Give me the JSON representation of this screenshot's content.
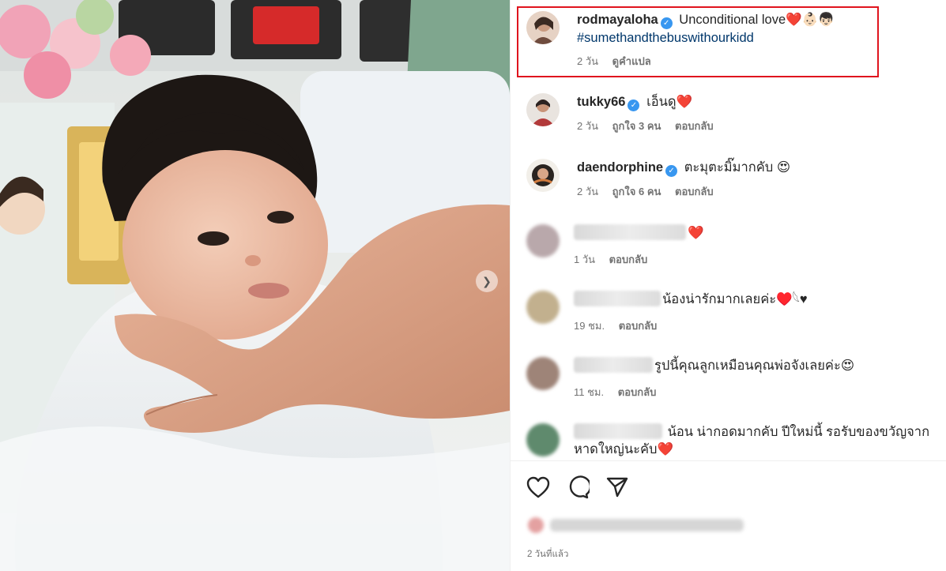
{
  "post": {
    "author": "rodmayaloha",
    "caption": "Unconditional love❤️👶🏻👦🏻",
    "hashtag": "#sumethandthebuswithourkidd",
    "time": "2 วัน",
    "translate_label": "ดูคำแปล",
    "posted_ago": "2 วันที่แล้ว"
  },
  "comments": [
    {
      "username": "tukky66",
      "verified": true,
      "text": "เอ็นดู❤️",
      "time": "2 วัน",
      "likes": "ถูกใจ 3 คน",
      "reply": "ตอบกลับ"
    },
    {
      "username": "daendorphine",
      "verified": true,
      "text": "ตะมุตะมิ๊มากคับ 😍",
      "time": "2 วัน",
      "likes": "ถูกใจ 6 คน",
      "reply": "ตอบกลับ"
    },
    {
      "username": "",
      "verified": false,
      "text": "❤️",
      "time": "1 วัน",
      "likes": "",
      "reply": "ตอบกลับ"
    },
    {
      "username": "",
      "verified": false,
      "text": "น้องน่ารักมากเลยค่ะ♥️𓆩♥",
      "time": "19 ชม.",
      "likes": "",
      "reply": "ตอบกลับ"
    },
    {
      "username": "",
      "verified": false,
      "text": "รูปนี้คุณลูกเหมือนคุณพ่อจังเลยค่ะ😍",
      "time": "11 ชม.",
      "likes": "",
      "reply": "ตอบกลับ"
    },
    {
      "username": "",
      "verified": false,
      "text": "น้อน น่ากอดมากคับ ปีใหม่นี้ รอรับของขวัญจาก",
      "text2": "หาดใหญ่นะคับ❤️",
      "time": "",
      "likes": "",
      "reply": ""
    }
  ],
  "icons": {
    "like": "heart-outline-icon",
    "comment": "comment-bubble-icon",
    "share": "paper-plane-icon",
    "next": "chevron-right-icon",
    "verified": "verified-badge-icon"
  },
  "colors": {
    "verified": "#3897f0",
    "highlight_box": "#e0141e",
    "hashtag": "#00376b",
    "meta_text": "#737373"
  }
}
